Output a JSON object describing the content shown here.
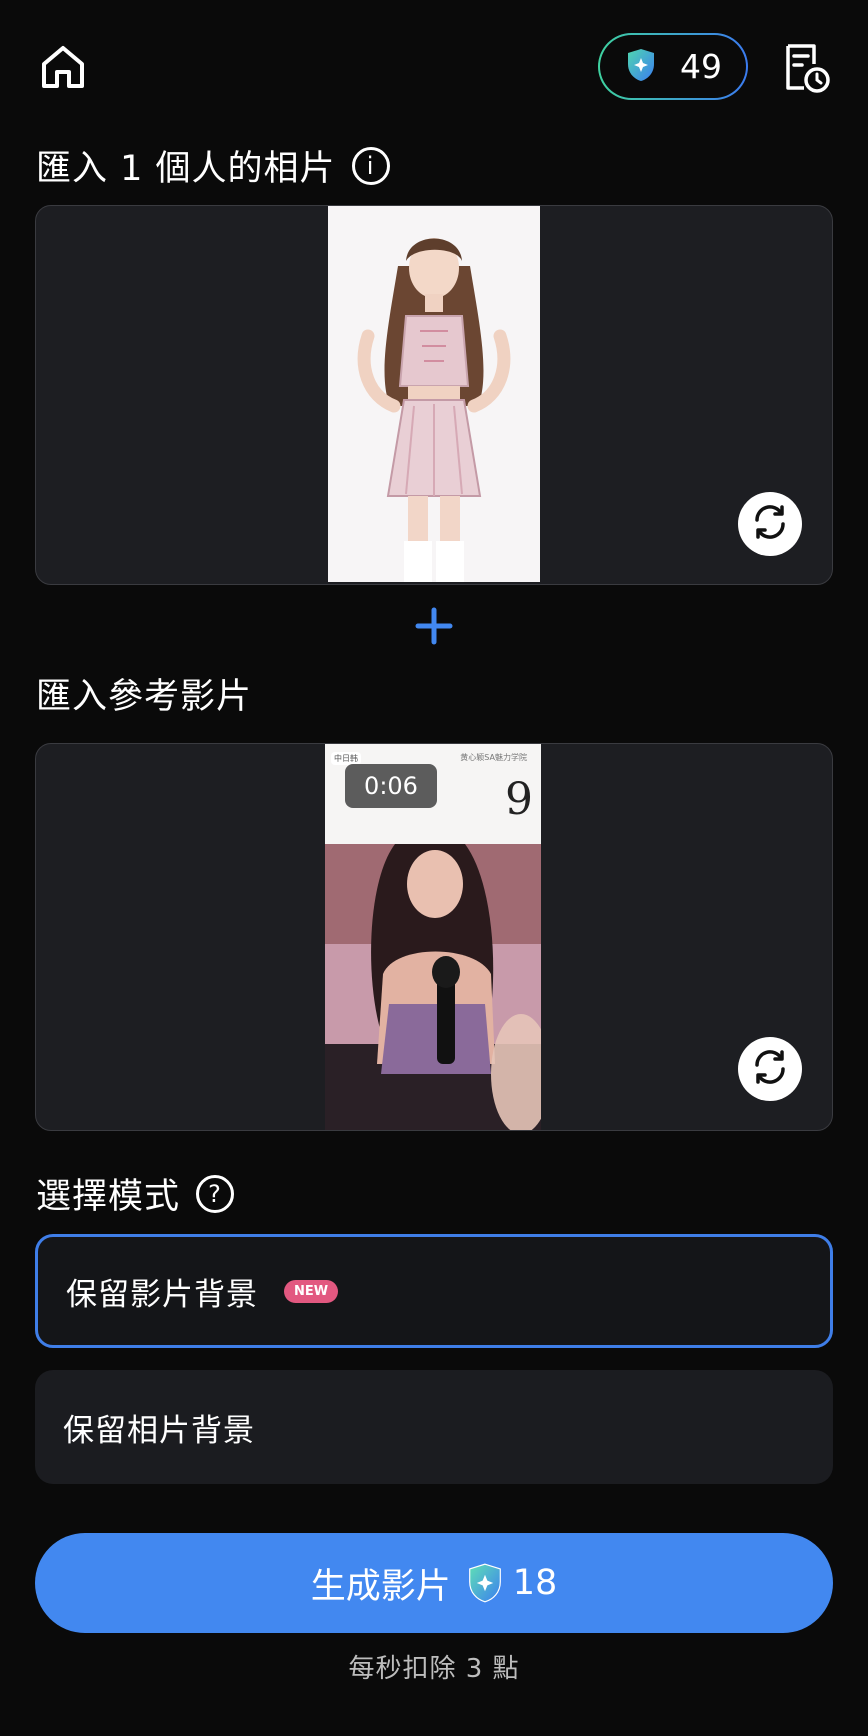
{
  "header": {
    "credits": "49"
  },
  "photo_section": {
    "title": "匯入 1 個人的相片"
  },
  "video_section": {
    "title": "匯入參考影片",
    "duration": "0:06",
    "video_overlay_number": "9",
    "video_tag_left": "中日韩",
    "video_tag_right": "黄心颖SA魅力学院"
  },
  "mode_section": {
    "title": "選擇模式",
    "options": [
      {
        "label": "保留影片背景",
        "badge": "NEW",
        "selected": true
      },
      {
        "label": "保留相片背景",
        "selected": false
      }
    ]
  },
  "generate": {
    "label": "生成影片",
    "cost": "18"
  },
  "footnote": "每秒扣除 3 點",
  "colors": {
    "accent": "#4288f0",
    "card": "#1d1e22",
    "badge": "#e25880",
    "background": "#0a0a0a"
  }
}
